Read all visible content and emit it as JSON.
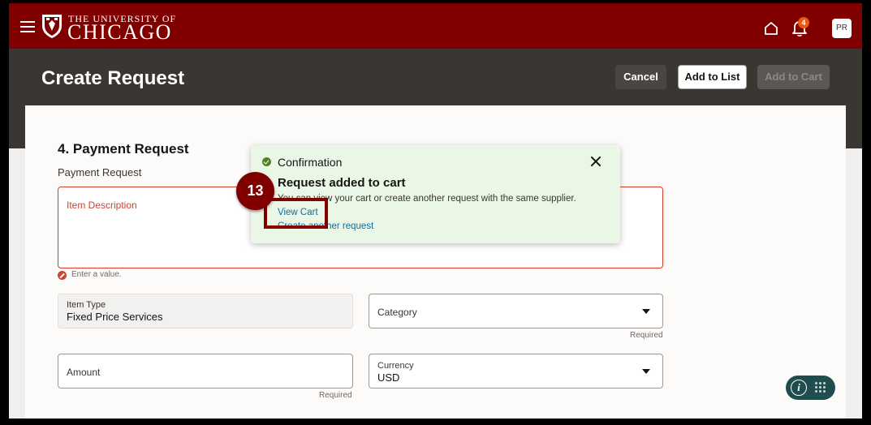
{
  "brand": {
    "line1": "THE UNIVERSITY OF",
    "line2": "CHICAGO"
  },
  "header": {
    "notifications_count": "4",
    "avatar_initials": "PR"
  },
  "page": {
    "title": "Create Request",
    "actions": {
      "cancel": "Cancel",
      "add_to_list": "Add to List",
      "add_to_cart": "Add to Cart"
    }
  },
  "form": {
    "section_title": "4. Payment Request",
    "subtitle": "Payment Request",
    "item_description": {
      "label": "Item Description",
      "error": "Enter a value."
    },
    "item_type": {
      "label": "Item Type",
      "value": "Fixed Price Services"
    },
    "category": {
      "label": "Category",
      "hint": "Required"
    },
    "amount": {
      "label": "Amount",
      "hint": "Required"
    },
    "currency": {
      "label": "Currency",
      "value": "USD"
    }
  },
  "toast": {
    "heading": "Confirmation",
    "title": "Request added to cart",
    "message": "You can view your cart or create another request with the same supplier.",
    "link_view_cart": "View Cart",
    "link_create_another": "Create another request"
  },
  "tutorial": {
    "step_number": "13"
  },
  "colors": {
    "brand_maroon": "#800000",
    "header_dark": "#3a3632",
    "toast_bg": "#ebf7e6",
    "link": "#0c6e9e",
    "error": "#c74634"
  }
}
